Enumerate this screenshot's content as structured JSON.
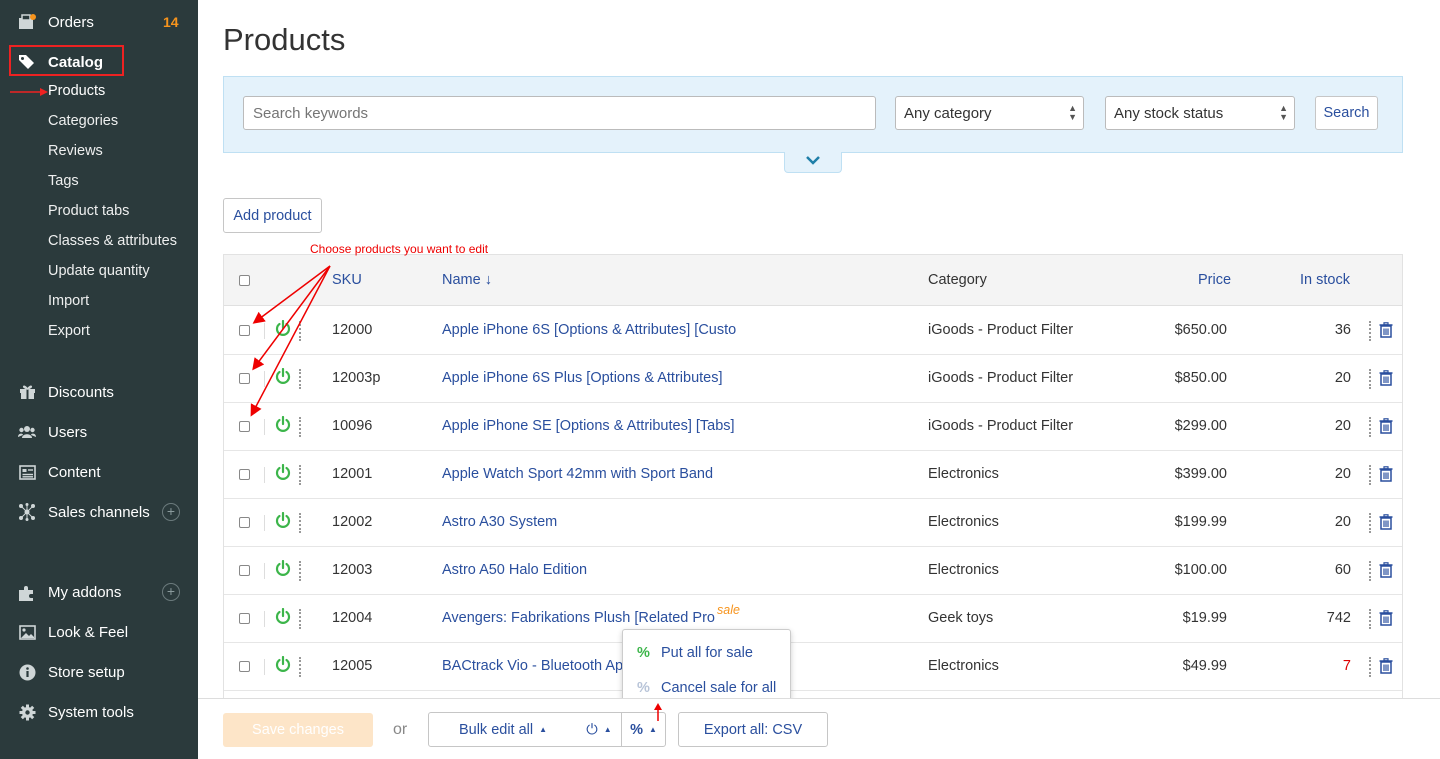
{
  "sidebar": {
    "orders": {
      "label": "Orders",
      "badge": "14"
    },
    "catalog": {
      "label": "Catalog"
    },
    "catalog_items": [
      "Products",
      "Categories",
      "Reviews",
      "Tags",
      "Product tabs",
      "Classes & attributes",
      "Update quantity",
      "Import",
      "Export"
    ],
    "discounts": "Discounts",
    "users": "Users",
    "content": "Content",
    "sales_channels": "Sales channels",
    "my_addons": "My addons",
    "look_feel": "Look & Feel",
    "store_setup": "Store setup",
    "system_tools": "System tools"
  },
  "page": {
    "title": "Products"
  },
  "filter": {
    "search_placeholder": "Search keywords",
    "category": "Any category",
    "stock_status": "Any stock status",
    "search_button": "Search"
  },
  "add_product": "Add product",
  "annotation": "Choose products you want to edit",
  "table": {
    "headers": {
      "sku": "SKU",
      "name": "Name ↓",
      "category": "Category",
      "price": "Price",
      "stock": "In stock"
    },
    "rows": [
      {
        "sku": "12000",
        "name": "Apple iPhone 6S [Options & Attributes] [Custo",
        "category": "iGoods - Product Filter",
        "price": "$650.00",
        "stock": "36"
      },
      {
        "sku": "12003p",
        "name": "Apple iPhone 6S Plus [Options & Attributes]",
        "category": "iGoods - Product Filter",
        "price": "$850.00",
        "stock": "20"
      },
      {
        "sku": "10096",
        "name": "Apple iPhone SE [Options & Attributes] [Tabs]",
        "category": "iGoods - Product Filter",
        "price": "$299.00",
        "stock": "20"
      },
      {
        "sku": "12001",
        "name": "Apple Watch Sport 42mm with Sport Band",
        "category": "Electronics",
        "price": "$399.00",
        "stock": "20"
      },
      {
        "sku": "12002",
        "name": "Astro A30 System",
        "category": "Electronics",
        "price": "$199.99",
        "stock": "20"
      },
      {
        "sku": "12003",
        "name": "Astro A50 Halo Edition",
        "category": "Electronics",
        "price": "$100.00",
        "stock": "60"
      },
      {
        "sku": "12004",
        "name": "Avengers: Fabrikations Plush [Related Pro",
        "category": "Geek toys",
        "price": "$19.99",
        "stock": "742"
      },
      {
        "sku": "12005",
        "name": "BACtrack Vio - Bluetooth Ap",
        "category": "Electronics",
        "price": "$49.99",
        "stock": "7"
      }
    ]
  },
  "sale_tag": "sale",
  "sale_menu": {
    "pct_icon": "%",
    "put_all": "Put all for sale",
    "cancel_all": "Cancel sale for all"
  },
  "footer": {
    "save": "Save changes",
    "or": "or",
    "bulk_edit": "Bulk edit all",
    "power_icon": "⏻",
    "pct_icon": "%",
    "export": "Export all: CSV"
  },
  "colors": {
    "sidebar_bg": "#2b3a3c",
    "link": "#2a4f9e",
    "badge": "#f7941d",
    "power": "#3cb54a",
    "annotation": "#e00"
  }
}
